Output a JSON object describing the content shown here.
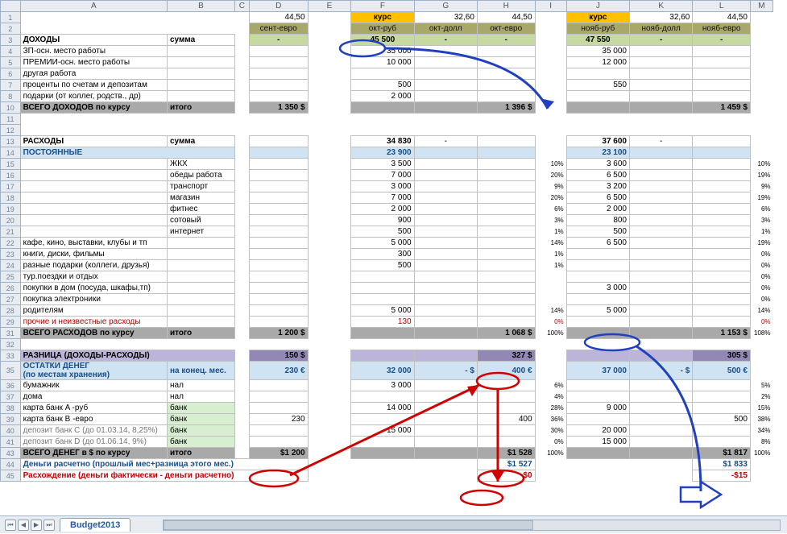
{
  "cols": [
    "A",
    "B",
    "C",
    "D",
    "E",
    "F",
    "G",
    "H",
    "I",
    "J",
    "K",
    "L",
    "M"
  ],
  "rows": [
    "1",
    "2",
    "3",
    "4",
    "5",
    "6",
    "7",
    "8",
    "10",
    "11",
    "12",
    "13",
    "14",
    "15",
    "16",
    "17",
    "18",
    "19",
    "20",
    "21",
    "22",
    "23",
    "24",
    "25",
    "26",
    "27",
    "28",
    "29",
    "31",
    "32",
    "33",
    "35",
    "36",
    "37",
    "38",
    "39",
    "40",
    "41",
    "43",
    "44",
    "45"
  ],
  "r1": {
    "D": "44,50",
    "F_lbl": "курс",
    "G": "32,60",
    "H": "44,50",
    "J_lbl": "курс",
    "K": "32,60",
    "L": "44,50"
  },
  "r2": {
    "D": "сент-евро",
    "F": "окт-руб",
    "G": "окт-долл",
    "H": "окт-евро",
    "J": "нояб-руб",
    "K": "нояб-долл",
    "L": "нояб-евро"
  },
  "income": {
    "title": "ДОХОДЫ",
    "sum_lbl": "сумма",
    "rows": [
      {
        "a": "ЗП-осн. место работы",
        "f": "35 000",
        "j": "35 000"
      },
      {
        "a": "ПРЕМИИ-осн. место работы",
        "f": "10 000",
        "j": "12 000"
      },
      {
        "a": "другая работа"
      },
      {
        "a": "проценты по счетам и депозитам",
        "f": "500",
        "j": "550"
      },
      {
        "a": "подарки (от коллег, родств., др)",
        "f": "2 000"
      }
    ],
    "total_lbl": "ВСЕГО ДОХОДОВ по курсу",
    "total_b": "итого",
    "total_d": "1 350 $",
    "total_h": "1 396 $",
    "total_l": "1 459 $",
    "f_head": "45 500",
    "g_head": "-",
    "h_head": "-",
    "j_head": "47 550",
    "k_head": "-",
    "l_head": "-",
    "d_head": "-"
  },
  "expenses": {
    "title": "РАСХОДЫ",
    "sum_lbl": "сумма",
    "f_head": "34 830",
    "g_head": "-",
    "j_head": "37 600",
    "k_head": "-",
    "const_lbl": "ПОСТОЯННЫЕ",
    "const_f": "23 900",
    "const_j": "23 100",
    "items": [
      {
        "b": "ЖКХ",
        "f": "3 500",
        "i": "10%",
        "j": "3 600",
        "m": "10%"
      },
      {
        "b": "обеды работа",
        "f": "7 000",
        "i": "20%",
        "j": "6 500",
        "m": "19%"
      },
      {
        "b": "транспорт",
        "f": "3 000",
        "i": "9%",
        "j": "3 200",
        "m": "9%"
      },
      {
        "b": "магазин",
        "f": "7 000",
        "i": "20%",
        "j": "6 500",
        "m": "19%"
      },
      {
        "b": "фитнес",
        "f": "2 000",
        "i": "6%",
        "j": "2 000",
        "m": "6%"
      },
      {
        "b": "сотовый",
        "f": "900",
        "i": "3%",
        "j": "800",
        "m": "3%"
      },
      {
        "b": "интернет",
        "f": "500",
        "i": "1%",
        "j": "500",
        "m": "1%"
      }
    ],
    "free": [
      {
        "a": "кафе, кино, выставки, клубы и тп",
        "f": "5 000",
        "i": "14%",
        "j": "6 500",
        "m": "19%"
      },
      {
        "a": "книги, диски, фильмы",
        "f": "300",
        "i": "1%",
        "m": "0%"
      },
      {
        "a": "разные подарки (коллеги, друзья)",
        "f": "500",
        "i": "1%",
        "m": "0%"
      },
      {
        "a": "тур.поездки и отдых",
        "m": "0%"
      },
      {
        "a": "покупки в дом (посуда, шкафы,тп)",
        "j": "3 000",
        "m": "0%"
      },
      {
        "a": "покупка электроники",
        "m": "0%"
      },
      {
        "a": "родителям",
        "f": "5 000",
        "i": "14%",
        "j": "5 000",
        "m": "14%"
      },
      {
        "a": "прочие и неизвестные расходы",
        "f": "130",
        "i": "0%",
        "m": "0%",
        "red": true
      }
    ],
    "total_lbl": "ВСЕГО РАСХОДОВ по курсу",
    "total_b": "итого",
    "total_d": "1 200 $",
    "total_h": "1 068 $",
    "total_i": "100%",
    "total_l": "1 153 $",
    "total_m": "108%"
  },
  "diff": {
    "lbl": "РАЗНИЦА (ДОХОДЫ-РАСХОДЫ)",
    "d": "150 $",
    "h": "327 $",
    "l": "305 $"
  },
  "remains": {
    "title": "ОСТАТКИ ДЕНЕГ",
    "sub": "(по местам хранения)",
    "b": "на конец. мес.",
    "d": "230 €",
    "f": "32 000",
    "g": "- $",
    "h": "400 €",
    "j": "37 000",
    "k": "- $",
    "l": "500 €",
    "items": [
      {
        "a": "бумажник",
        "b": "нал",
        "f": "3 000",
        "i": "6%",
        "m": "5%"
      },
      {
        "a": "дома",
        "b": "нал",
        "i": "4%",
        "m": "2%"
      },
      {
        "a": "карта банк A -руб",
        "b": "банк",
        "f": "14 000",
        "i": "28%",
        "j": "9 000",
        "m": "15%"
      },
      {
        "a": "карта банк B -евро",
        "b": "банк",
        "d": "230",
        "h": "400",
        "i": "36%",
        "l": "500",
        "m": "38%"
      },
      {
        "a": "депозит банк C (до 01.03.14, 8,25%)",
        "b": "банк",
        "f": "15 000",
        "i": "30%",
        "j": "20 000",
        "m": "34%"
      },
      {
        "a": "депозит банк D (до 01.06.14, 9%)",
        "b": "банк",
        "i": "0%",
        "j": "15 000",
        "m": "8%"
      }
    ]
  },
  "totalmoney": {
    "lbl": "ВСЕГО ДЕНЕГ в $ по курсу",
    "b": "итого",
    "d": "$1 200",
    "h": "$1 528",
    "i": "100%",
    "l": "$1 817",
    "m": "100%"
  },
  "calc": {
    "a": "Деньги расчетно (прошлый мес+разница этого мес.)",
    "h": "$1 527",
    "l": "$1 833",
    "b": "Расхождение (деньги фактически - деньги расчетно)",
    "bh": "$0",
    "bl": "-$15"
  },
  "tab": "Budget2013"
}
